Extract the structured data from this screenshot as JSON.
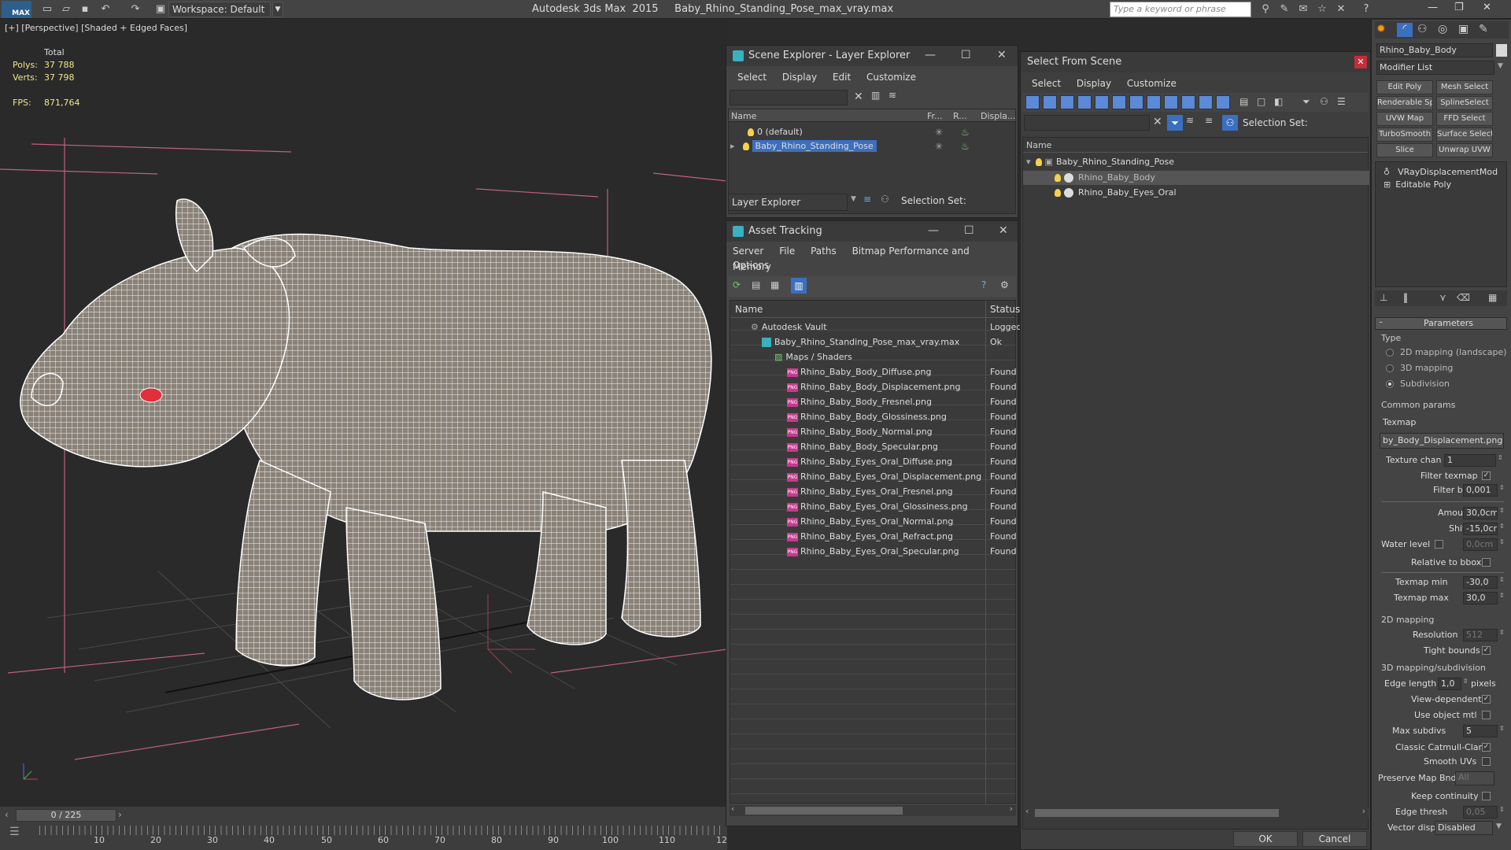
{
  "titlebar": {
    "logo_label": "MAX",
    "workspace_label": "Workspace: Default",
    "app_title": "Autodesk 3ds Max  2015     Baby_Rhino_Standing_Pose_max_vray.max",
    "search_placeholder": "Type a keyword or phrase"
  },
  "viewport": {
    "label": "[+] [Perspective] [Shaded + Edged Faces]",
    "total_label": "Total",
    "polys_label": "Polys:",
    "polys_value": "37 788",
    "verts_label": "Verts:",
    "verts_value": "37 798",
    "fps_label": "FPS:",
    "fps_value": "871,764",
    "mesh_color": "#8a8278",
    "eye_color": "#e0303a"
  },
  "timeline": {
    "slider_label": "0 / 225",
    "ticks": [
      "10",
      "20",
      "30",
      "40",
      "50",
      "60",
      "70",
      "80",
      "90",
      "100",
      "110",
      "12"
    ]
  },
  "scene_explorer": {
    "title": "Scene Explorer - Layer Explorer",
    "menu": [
      "Select",
      "Display",
      "Edit",
      "Customize"
    ],
    "col_name": "Name",
    "col_fr": "Fr...",
    "col_r": "R...",
    "col_disp": "Displa...",
    "rows": [
      "0 (default)",
      "Baby_Rhino_Standing_Pose"
    ],
    "footer_dropdown": "Layer Explorer",
    "selection_set_label": "Selection Set:"
  },
  "asset_tracking": {
    "title": "Asset Tracking",
    "menu": [
      "Server",
      "File",
      "Paths",
      "Bitmap Performance and Memory"
    ],
    "menu2": "Options",
    "col_name": "Name",
    "col_status": "Status",
    "vault": "Autodesk Vault",
    "vault_status": "Logged",
    "file": "Baby_Rhino_Standing_Pose_max_vray.max",
    "file_status": "Ok",
    "maps": "Maps / Shaders",
    "png_label": "PNG",
    "assets": [
      "Rhino_Baby_Body_Diffuse.png",
      "Rhino_Baby_Body_Displacement.png",
      "Rhino_Baby_Body_Fresnel.png",
      "Rhino_Baby_Body_Glossiness.png",
      "Rhino_Baby_Body_Normal.png",
      "Rhino_Baby_Body_Specular.png",
      "Rhino_Baby_Eyes_Oral_Diffuse.png",
      "Rhino_Baby_Eyes_Oral_Displacement.png",
      "Rhino_Baby_Eyes_Oral_Fresnel.png",
      "Rhino_Baby_Eyes_Oral_Glossiness.png",
      "Rhino_Baby_Eyes_Oral_Normal.png",
      "Rhino_Baby_Eyes_Oral_Refract.png",
      "Rhino_Baby_Eyes_Oral_Specular.png"
    ],
    "asset_status": "Found"
  },
  "select_from_scene": {
    "title": "Select From Scene",
    "menu": [
      "Select",
      "Display",
      "Customize"
    ],
    "selection_set_label": "Selection Set:",
    "col_name": "Name",
    "tree": [
      "Baby_Rhino_Standing_Pose",
      "Rhino_Baby_Body",
      "Rhino_Baby_Eyes_Oral"
    ],
    "ok": "OK",
    "cancel": "Cancel"
  },
  "command_panel": {
    "object_name": "Rhino_Baby_Body",
    "modifier_list": "Modifier List",
    "buttons": [
      "Edit Poly",
      "Mesh Select",
      "Renderable Spline",
      "SplineSelect",
      "UVW Map",
      "FFD Select",
      "TurboSmooth",
      "Surface Select",
      "Slice",
      "Unwrap UVW"
    ],
    "stack": [
      "VRayDisplacementMod",
      "Editable Poly"
    ],
    "params_title": "Parameters",
    "type_label": "Type",
    "type_options": [
      "2D mapping (landscape)",
      "3D mapping",
      "Subdivision"
    ],
    "common_params": "Common params",
    "texmap_label": "Texmap",
    "texmap_value": "by_Body_Displacement.png)",
    "texture_chan_label": "Texture chan",
    "texture_chan_value": "1",
    "filter_texmap_label": "Filter texmap",
    "filter_blur_label": "Filter blur",
    "filter_blur_value": "0,001",
    "amount_label": "Amount",
    "amount_value": "30,0cm",
    "shift_label": "Shift",
    "shift_value": "-15,0cm",
    "water_level_label": "Water level",
    "water_level_value": "0,0cm",
    "relative_bbox_label": "Relative to bbox",
    "texmap_min_label": "Texmap min",
    "texmap_min_value": "-30,0",
    "texmap_max_label": "Texmap max",
    "texmap_max_value": "30,0",
    "mapping_2d": "2D mapping",
    "resolution_label": "Resolution",
    "resolution_value": "512",
    "tight_bounds_label": "Tight bounds",
    "mapping_3d": "3D mapping/subdivision",
    "edge_length_label": "Edge length",
    "edge_length_value": "1,0",
    "pixels_label": "pixels",
    "view_dependent_label": "View-dependent",
    "use_object_mtl_label": "Use object mtl",
    "max_subdivs_label": "Max subdivs",
    "max_subdivs_value": "5",
    "catmull_label": "Classic Catmull-Clark",
    "smooth_uvs_label": "Smooth UVs",
    "preserve_map_label": "Preserve Map Bnd",
    "preserve_map_value": "All",
    "keep_continuity_label": "Keep continuity",
    "edge_thresh_label": "Edge thresh",
    "edge_thresh_value": "0,05",
    "vector_disp_label": "Vector displ",
    "vector_disp_value": "Disabled"
  }
}
